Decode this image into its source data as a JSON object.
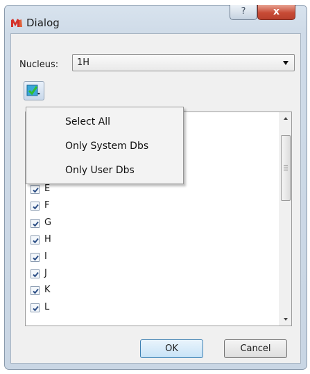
{
  "window": {
    "title": "Dialog",
    "help_glyph": "?",
    "close_glyph": "x"
  },
  "nucleus": {
    "label": "Nucleus:",
    "selected": "1H"
  },
  "menu": {
    "items": [
      "Select All",
      "Only System Dbs",
      "Only User Dbs"
    ]
  },
  "list": {
    "items": [
      {
        "label": "E",
        "checked": true
      },
      {
        "label": "F",
        "checked": true
      },
      {
        "label": "G",
        "checked": true
      },
      {
        "label": "H",
        "checked": true
      },
      {
        "label": "I",
        "checked": true
      },
      {
        "label": "J",
        "checked": true
      },
      {
        "label": "K",
        "checked": true
      },
      {
        "label": "L",
        "checked": true
      }
    ]
  },
  "buttons": {
    "ok": "OK",
    "cancel": "Cancel"
  },
  "icons": {
    "app": "mestrelab-logo-icon",
    "toolbar": "green-check-icon"
  }
}
